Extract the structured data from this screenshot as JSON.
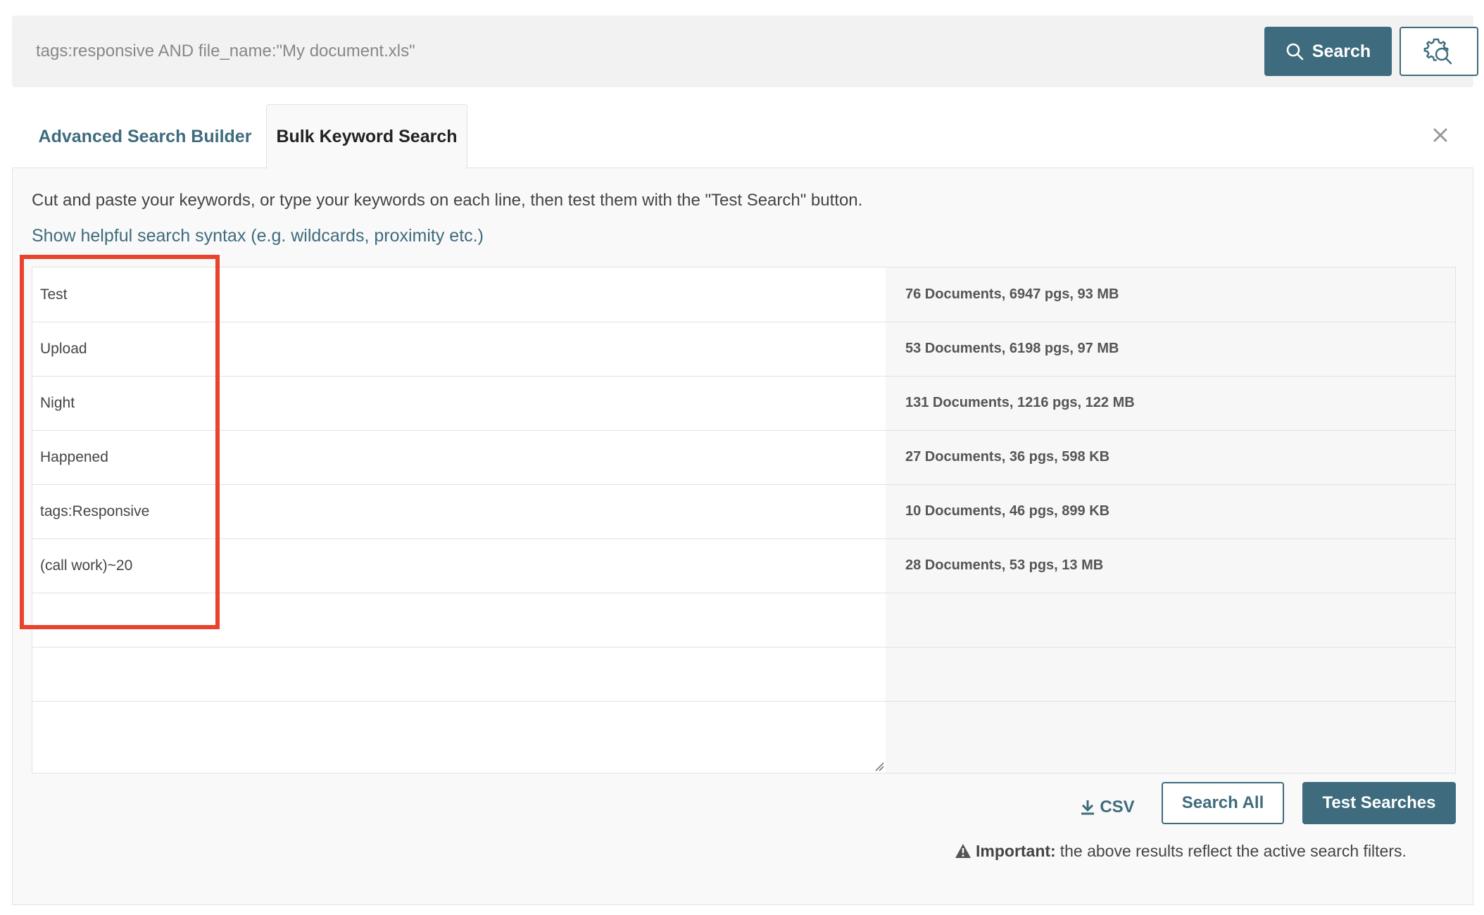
{
  "search": {
    "query": "tags:responsive AND file_name:\"My document.xls\"",
    "button_label": "Search"
  },
  "tabs": [
    {
      "label": "Advanced Search Builder"
    },
    {
      "label": "Bulk Keyword Search"
    }
  ],
  "panel": {
    "instructions": "Cut and paste your keywords, or type your keywords on each line, then test them with the \"Test Search\" button.",
    "syntax_link": "Show helpful search syntax (e.g. wildcards, proximity etc.)",
    "rows": [
      {
        "keyword": "Test",
        "result": "76 Documents, 6947 pgs, 93 MB"
      },
      {
        "keyword": "Upload",
        "result": "53 Documents, 6198 pgs, 97 MB"
      },
      {
        "keyword": "Night",
        "result": "131 Documents, 1216 pgs, 122 MB"
      },
      {
        "keyword": "Happened",
        "result": "27 Documents, 36 pgs, 598 KB"
      },
      {
        "keyword": "tags:Responsive",
        "result": "10 Documents, 46 pgs, 899 KB"
      },
      {
        "keyword": "(call work)~20",
        "result": "28 Documents, 53 pgs, 13 MB"
      },
      {
        "keyword": "",
        "result": ""
      },
      {
        "keyword": "",
        "result": ""
      },
      {
        "keyword": "",
        "result": ""
      }
    ]
  },
  "actions": {
    "csv_label": "CSV",
    "search_all_label": "Search All",
    "test_searches_label": "Test Searches"
  },
  "notice": {
    "important_label": "Important:",
    "text": "the above results reflect the active search filters."
  },
  "colors": {
    "accent": "#3e6b7d",
    "highlight": "#e8432c"
  }
}
